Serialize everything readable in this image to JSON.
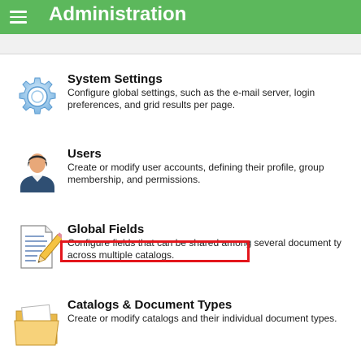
{
  "header": {
    "menu_icon": "hamburger-menu-icon",
    "title": "Administration",
    "background_color": "#5cb85c"
  },
  "items": [
    {
      "icon": "gear-icon",
      "title": "System Settings",
      "desc_line1": "Configure global settings, such as the e-mail server, login",
      "desc_line2": "preferences, and grid results per page."
    },
    {
      "icon": "user-icon",
      "title": "Users",
      "desc_line1": "Create or modify user accounts, defining their profile, group",
      "desc_line2": "membership, and permissions."
    },
    {
      "icon": "document-pencil-icon",
      "title": "Global Fields",
      "desc_line1": "Configure fields that can be shared among several document ty",
      "desc_line2": "across multiple catalogs."
    },
    {
      "icon": "folder-icon",
      "title": "Catalogs & Document Types",
      "desc_line1": "Create or modify catalogs and their individual document types."
    }
  ],
  "highlight_color": "#e3161c"
}
